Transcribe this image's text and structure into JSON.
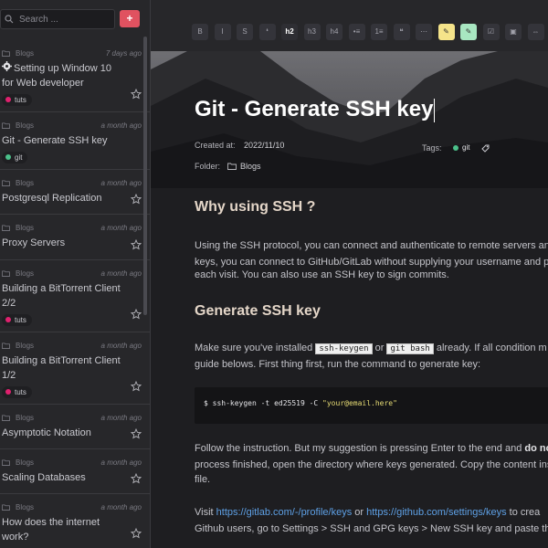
{
  "sidebar": {
    "search_placeholder": "Search ...",
    "add_label": "+",
    "notes": [
      {
        "folder": "Blogs",
        "time": "7 days ago",
        "title": "Setting up Window 10 for Web developer",
        "has_gear": true,
        "tag": "tuts",
        "tag_color": "#e0206e",
        "starred": true
      },
      {
        "folder": "Blogs",
        "time": "a month ago",
        "title": "Git - Generate SSH key",
        "has_gear": false,
        "tag": "git",
        "tag_color": "#4bc08a",
        "starred": false
      },
      {
        "folder": "Blogs",
        "time": "a month ago",
        "title": "Postgresql Replication",
        "has_gear": false,
        "tag": "",
        "starred": true
      },
      {
        "folder": "Blogs",
        "time": "a month ago",
        "title": "Proxy Servers",
        "has_gear": false,
        "tag": "",
        "starred": true
      },
      {
        "folder": "Blogs",
        "time": "a month ago",
        "title": "Building a BitTorrent Client 2/2",
        "has_gear": false,
        "tag": "tuts",
        "tag_color": "#e0206e",
        "starred": true
      },
      {
        "folder": "Blogs",
        "time": "a month ago",
        "title": "Building a BitTorrent Client 1/2",
        "has_gear": false,
        "tag": "tuts",
        "tag_color": "#e0206e",
        "starred": true
      },
      {
        "folder": "Blogs",
        "time": "a month ago",
        "title": "Asymptotic Notation",
        "has_gear": false,
        "tag": "",
        "starred": true
      },
      {
        "folder": "Blogs",
        "time": "a month ago",
        "title": "Scaling Databases",
        "has_gear": false,
        "tag": "",
        "starred": true
      },
      {
        "folder": "Blogs",
        "time": "a month ago",
        "title": "How does the internet work?",
        "has_gear": false,
        "tag": "",
        "starred": true
      }
    ]
  },
  "toolbar": {
    "buttons": [
      "B",
      "I",
      "S",
      "❛",
      "h2",
      "h3",
      "h4",
      "•≡",
      "1≡",
      "❝",
      "⋯",
      "✎",
      "✎",
      "☑",
      "▣",
      "⇔"
    ]
  },
  "note": {
    "title": "Git - Generate SSH key",
    "created_label": "Created at:",
    "created_value": "2022/11/10",
    "tags_label": "Tags:",
    "tag": "git",
    "folder_label": "Folder:",
    "folder_value": "Blogs"
  },
  "content": {
    "h_why": "Why using SSH ?",
    "p1_l1": "Using the SSH protocol, you can connect and authenticate to remote servers and",
    "p1_l2": "keys, you can connect to GitHub/GitLab without supplying your username and pe",
    "p1_l3": "each visit. You can also use an SSH key to sign commits.",
    "h_gen": "Generate SSH key",
    "p2_a": "Make sure you've installed",
    "p2_code1": "ssh-keygen",
    "p2_or": "or",
    "p2_code2": "git bash",
    "p2_b": "already. If all condition m",
    "p2_l2": "guide belows. First thing first, run the command to generate key:",
    "code_cmd": "$ ssh-keygen -t ed25519 -C ",
    "code_str": "\"your@email.here\"",
    "p3_l1a": "Follow the instruction. But my suggestion is pressing Enter to the end and ",
    "p3_l1b": "do not",
    "p3_l2": "process finished, open the directory where keys generated. Copy the content insi",
    "p3_l3": "file.",
    "p4_a": "Visit ",
    "p4_link1": "https://gitlab.com/-/profile/keys",
    "p4_or": " or ",
    "p4_link2": "https://github.com/settings/keys",
    "p4_b": " to crea",
    "p4_l2": "Github users, go to Settings > SSH and GPG keys > New SSH key and paste the p"
  }
}
